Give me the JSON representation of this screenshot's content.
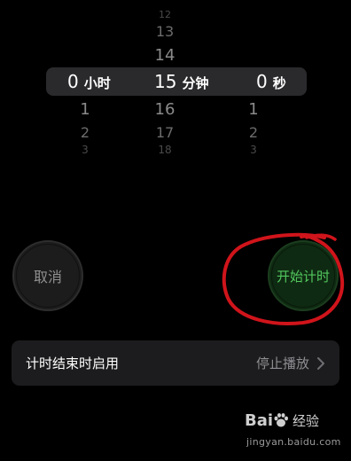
{
  "picker": {
    "hours_col": {
      "above": [
        "",
        "",
        ""
      ],
      "selected": "0",
      "unit": "小时",
      "below": [
        "1",
        "2",
        "3"
      ]
    },
    "minutes_col": {
      "above": [
        "12",
        "13",
        "14"
      ],
      "selected": "15",
      "unit": "分钟",
      "below": [
        "16",
        "17",
        "18"
      ]
    },
    "seconds_col": {
      "above": [
        "",
        "",
        ""
      ],
      "selected": "0",
      "unit": "秒",
      "below": [
        "1",
        "2",
        "3"
      ]
    }
  },
  "buttons": {
    "cancel_label": "取消",
    "start_label": "开始计时"
  },
  "when_timer_ends": {
    "label": "计时结束时启用",
    "value": "停止播放"
  },
  "watermark": {
    "brand_prefix": "Bai",
    "brand_suffix": "经验",
    "url": "jingyan.baidu.com"
  },
  "colors": {
    "background": "#000000",
    "start_button_text": "#52c85e",
    "annotation_circle": "#d0141b",
    "row_background": "#1c1c1e"
  },
  "icons": {
    "chevron": "chevron-right-icon",
    "watermark_paw": "baidu-paw-icon"
  }
}
